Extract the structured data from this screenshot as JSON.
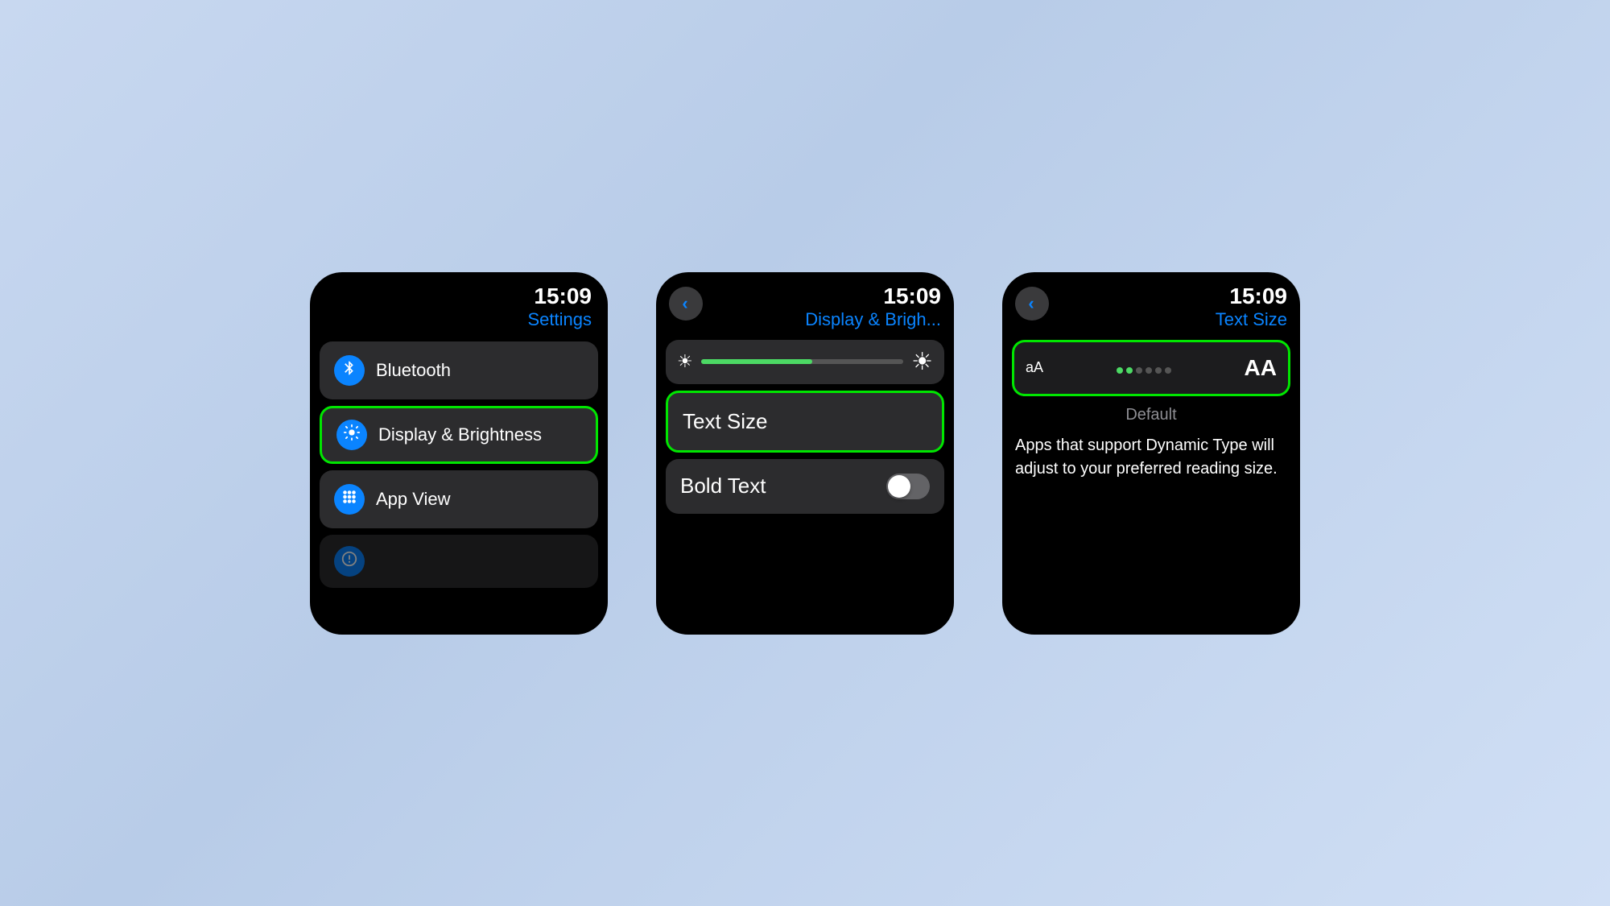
{
  "background": {
    "color_start": "#c8d8f0",
    "color_end": "#d0dff5"
  },
  "screen1": {
    "time": "15:09",
    "title": "Settings",
    "items": [
      {
        "id": "bluetooth",
        "label": "Bluetooth",
        "icon": "bluetooth",
        "highlighted": false
      },
      {
        "id": "display-brightness",
        "label": "Display & Brightness",
        "icon": "sun",
        "highlighted": true
      },
      {
        "id": "app-view",
        "label": "App View",
        "icon": "grid",
        "highlighted": false
      }
    ]
  },
  "screen2": {
    "time": "15:09",
    "title": "Display & Brigh...",
    "back_label": "back",
    "brightness_slider_pct": 55,
    "items": [
      {
        "id": "text-size",
        "label": "Text Size",
        "highlighted": true
      }
    ],
    "bold_text_label": "Bold Text",
    "bold_text_enabled": false
  },
  "screen3": {
    "time": "15:09",
    "title": "Text Size",
    "back_label": "back",
    "size_small_label": "aA",
    "size_large_label": "AA",
    "slider_pct": 40,
    "default_label": "Default",
    "description": "Apps that support Dynamic Type will adjust to your preferred reading size."
  }
}
